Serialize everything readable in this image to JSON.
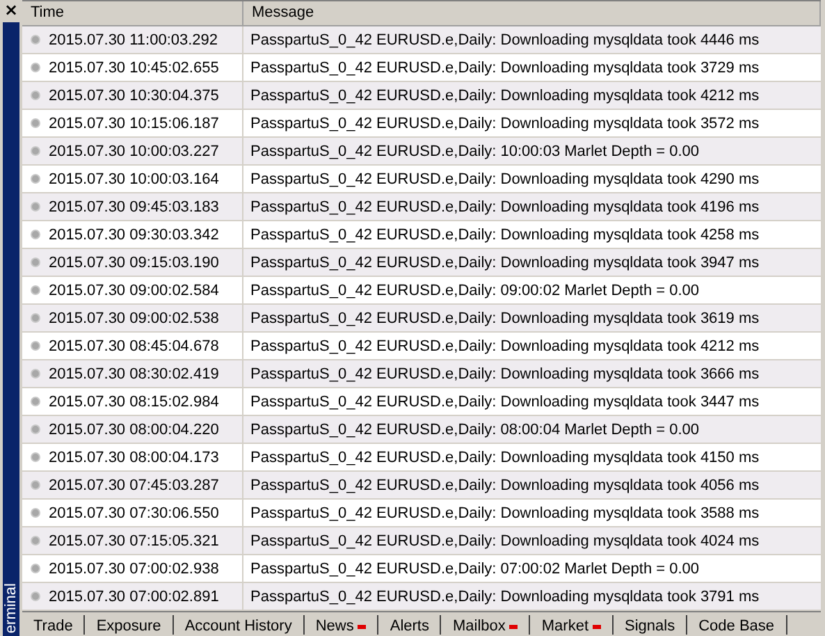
{
  "sidebar": {
    "close": "×",
    "title": "erminal"
  },
  "table": {
    "columns": [
      "Time",
      "Message"
    ],
    "rows": [
      {
        "time": "2015.07.30 11:00:03.292",
        "message": "PasspartuS_0_42 EURUSD.e,Daily: Downloading mysqldata took 4446 ms"
      },
      {
        "time": "2015.07.30 10:45:02.655",
        "message": "PasspartuS_0_42 EURUSD.e,Daily: Downloading mysqldata took 3729 ms"
      },
      {
        "time": "2015.07.30 10:30:04.375",
        "message": "PasspartuS_0_42 EURUSD.e,Daily: Downloading mysqldata took 4212 ms"
      },
      {
        "time": "2015.07.30 10:15:06.187",
        "message": "PasspartuS_0_42 EURUSD.e,Daily: Downloading mysqldata took 3572 ms"
      },
      {
        "time": "2015.07.30 10:00:03.227",
        "message": "PasspartuS_0_42 EURUSD.e,Daily: 10:00:03 Marlet Depth = 0.00"
      },
      {
        "time": "2015.07.30 10:00:03.164",
        "message": "PasspartuS_0_42 EURUSD.e,Daily: Downloading mysqldata took 4290 ms"
      },
      {
        "time": "2015.07.30 09:45:03.183",
        "message": "PasspartuS_0_42 EURUSD.e,Daily: Downloading mysqldata took 4196 ms"
      },
      {
        "time": "2015.07.30 09:30:03.342",
        "message": "PasspartuS_0_42 EURUSD.e,Daily: Downloading mysqldata took 4258 ms"
      },
      {
        "time": "2015.07.30 09:15:03.190",
        "message": "PasspartuS_0_42 EURUSD.e,Daily: Downloading mysqldata took 3947 ms"
      },
      {
        "time": "2015.07.30 09:00:02.584",
        "message": "PasspartuS_0_42 EURUSD.e,Daily: 09:00:02 Marlet Depth = 0.00"
      },
      {
        "time": "2015.07.30 09:00:02.538",
        "message": "PasspartuS_0_42 EURUSD.e,Daily: Downloading mysqldata took 3619 ms"
      },
      {
        "time": "2015.07.30 08:45:04.678",
        "message": "PasspartuS_0_42 EURUSD.e,Daily: Downloading mysqldata took 4212 ms"
      },
      {
        "time": "2015.07.30 08:30:02.419",
        "message": "PasspartuS_0_42 EURUSD.e,Daily: Downloading mysqldata took 3666 ms"
      },
      {
        "time": "2015.07.30 08:15:02.984",
        "message": "PasspartuS_0_42 EURUSD.e,Daily: Downloading mysqldata took 3447 ms"
      },
      {
        "time": "2015.07.30 08:00:04.220",
        "message": "PasspartuS_0_42 EURUSD.e,Daily: 08:00:04 Marlet Depth = 0.00"
      },
      {
        "time": "2015.07.30 08:00:04.173",
        "message": "PasspartuS_0_42 EURUSD.e,Daily: Downloading mysqldata took 4150 ms"
      },
      {
        "time": "2015.07.30 07:45:03.287",
        "message": "PasspartuS_0_42 EURUSD.e,Daily: Downloading mysqldata took 4056 ms"
      },
      {
        "time": "2015.07.30 07:30:06.550",
        "message": "PasspartuS_0_42 EURUSD.e,Daily: Downloading mysqldata took 3588 ms"
      },
      {
        "time": "2015.07.30 07:15:05.321",
        "message": "PasspartuS_0_42 EURUSD.e,Daily: Downloading mysqldata took 4024 ms"
      },
      {
        "time": "2015.07.30 07:00:02.938",
        "message": "PasspartuS_0_42 EURUSD.e,Daily: 07:00:02 Marlet Depth = 0.00"
      },
      {
        "time": "2015.07.30 07:00:02.891",
        "message": "PasspartuS_0_42 EURUSD.e,Daily: Downloading mysqldata took 3791 ms"
      }
    ]
  },
  "tabs": [
    {
      "label": "Trade",
      "badge": false
    },
    {
      "label": "Exposure",
      "badge": false
    },
    {
      "label": "Account History",
      "badge": false
    },
    {
      "label": "News",
      "badge": true
    },
    {
      "label": "Alerts",
      "badge": false
    },
    {
      "label": "Mailbox",
      "badge": true
    },
    {
      "label": "Market",
      "badge": true
    },
    {
      "label": "Signals",
      "badge": false
    },
    {
      "label": "Code Base",
      "badge": false
    }
  ]
}
